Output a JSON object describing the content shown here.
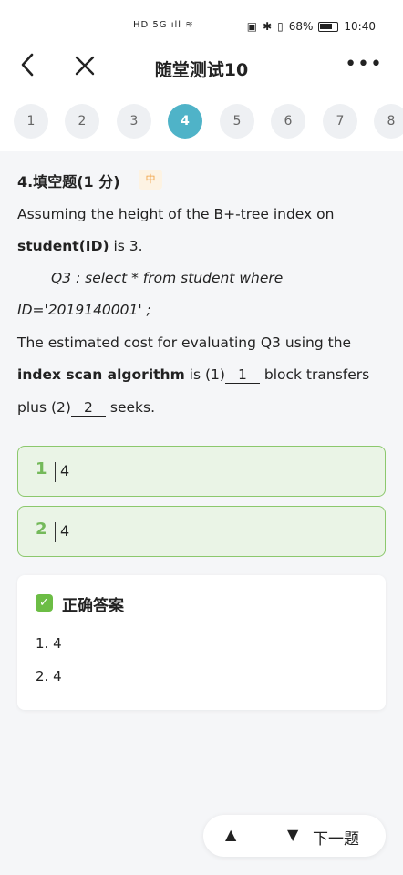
{
  "status_bar": {
    "left_icons": "HD 5G ıll ≋",
    "battery_pct": "68%",
    "time": "10:40"
  },
  "header": {
    "title": "随堂测试10",
    "more": "•••"
  },
  "question_nav": [
    "1",
    "2",
    "3",
    "4",
    "5",
    "6",
    "7",
    "8"
  ],
  "question_nav_active": "4",
  "question": {
    "type": "4.填空题(1 分)",
    "difficulty": "中",
    "line1": "Assuming the height of the B+-tree index on",
    "line2_bold": "student(ID)",
    "line2_rest": " is 3.",
    "line3": "Q3 : select * from student where",
    "line4": "ID='2019140001' ;",
    "line5": "The estimated cost for evaluating Q3 using the",
    "line6_bold": "index scan algorithm",
    "line6_a": " is (1)",
    "blank1": "1",
    "line6_b": " block transfers",
    "line7_a": "plus (2)",
    "blank2": "2",
    "line7_b": " seeks."
  },
  "answers": [
    {
      "index": "1",
      "value": "4"
    },
    {
      "index": "2",
      "value": "4"
    }
  ],
  "correct": {
    "title": "正确答案",
    "check": "✓",
    "items": [
      "1. 4",
      "2. 4"
    ]
  },
  "bottom_nav": {
    "up": "▲",
    "down": "▼",
    "next_label": "下一题"
  }
}
